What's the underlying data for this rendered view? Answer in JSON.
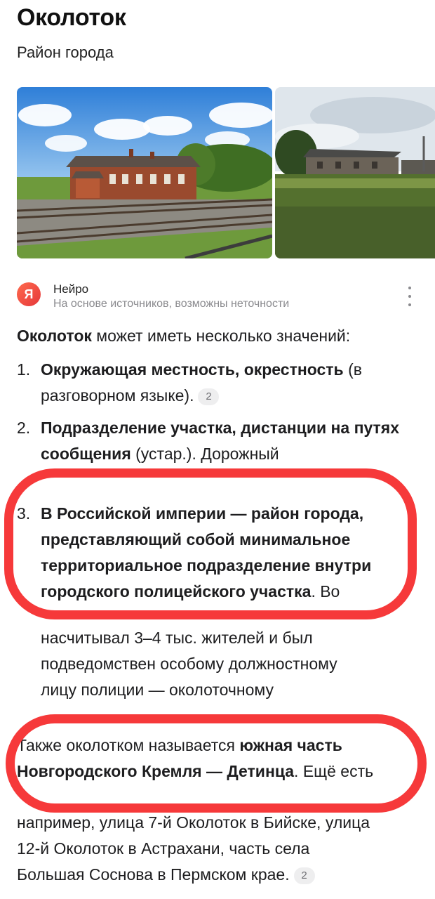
{
  "header": {
    "title": "Околоток",
    "subtitle": "Район города"
  },
  "images": [
    {
      "name": "railway-station-photo"
    },
    {
      "name": "village-field-photo"
    }
  ],
  "neuro": {
    "logo_glyph": "Я",
    "name": "Нейро",
    "note": "На основе источников, возможны неточности"
  },
  "answer": {
    "intro_bold": "Околоток",
    "intro_rest": " может иметь несколько значений:",
    "items": [
      {
        "num": "1.",
        "bold": "Окружающая местность, окрестность",
        "rest": " (в разговорном языке).",
        "source": "2"
      },
      {
        "num": "2.",
        "bold": "Подразделение участка, дистанции на путях сообщения",
        "rest": " (устар.). Дорожный"
      },
      {
        "num": "3.",
        "bold": "В Российской империи — район города, представляющий собой минимальное территориальное подразделение внутри городского полицейского участка",
        "rest": ". Во",
        "line_continuation_1": "насчитывал 3–4 тыс. жителей и был",
        "line_continuation_2": "подведомствен особому должностному",
        "line_continuation_3": "лицу полиции — околоточному"
      }
    ],
    "extra_plain": "Также околотком называется ",
    "extra_bold": "южная часть Новгородского Кремля — Детинца",
    "extra_rest": ". Ещё есть",
    "extra_line_2": "например, улица 7-й Околоток в Бийске, улица",
    "extra_line_3": "12-й Околоток в Астрахани, часть села",
    "extra_line_4": "Большая Соснова в Пермском крае.",
    "extra_source": "2"
  },
  "annotation_colors": {
    "oval_color": "#f6393a"
  }
}
